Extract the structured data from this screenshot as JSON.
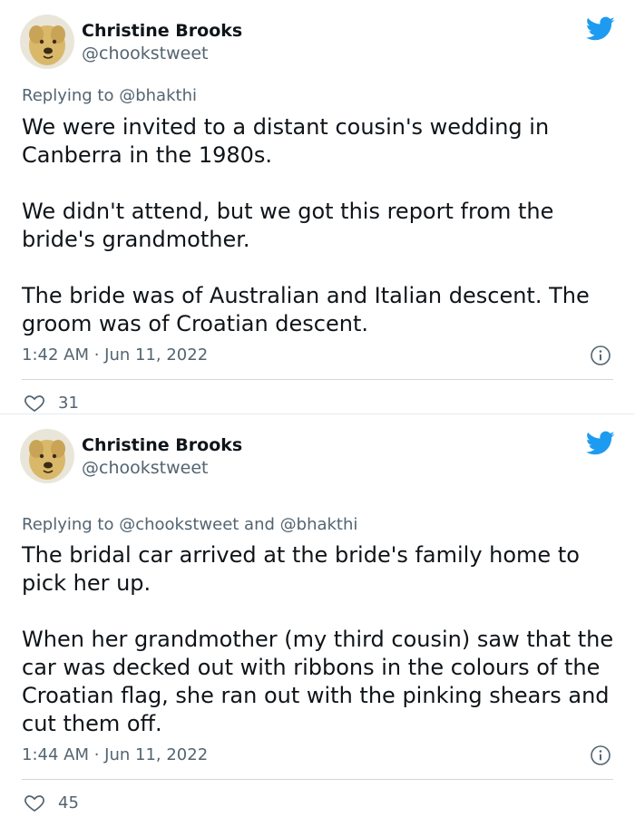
{
  "tweets": [
    {
      "author_name": "Christine Brooks",
      "author_handle": "@chookstweet",
      "reply_prefix": "Replying to",
      "reply_mentions": "@bhakthi",
      "paragraphs": [
        "We were invited to a distant cousin's wedding in Canberra in the 1980s.",
        "We didn't attend, but we got this report from the bride's grandmother.",
        "The bride was of Australian and Italian descent. The groom was of Croatian descent."
      ],
      "timestamp": "1:42 AM · Jun 11, 2022",
      "like_count": "31"
    },
    {
      "author_name": "Christine Brooks",
      "author_handle": "@chookstweet",
      "reply_prefix": "Replying to",
      "reply_mentions": "@chookstweet and @bhakthi",
      "paragraphs": [
        "The bridal car arrived at the bride's family home to pick her up.",
        "When her grandmother (my third cousin) saw that the car was decked out with ribbons in the colours of the Croatian flag, she ran out with the pinking shears and cut them off."
      ],
      "timestamp": "1:44 AM · Jun 11, 2022",
      "like_count": "45"
    }
  ],
  "colors": {
    "twitter_blue": "#1d9bf0",
    "secondary_text": "#536471",
    "primary_text": "#0f1419"
  },
  "icons": [
    "twitter-bird-icon",
    "info-icon",
    "heart-icon",
    "avatar-dog"
  ]
}
